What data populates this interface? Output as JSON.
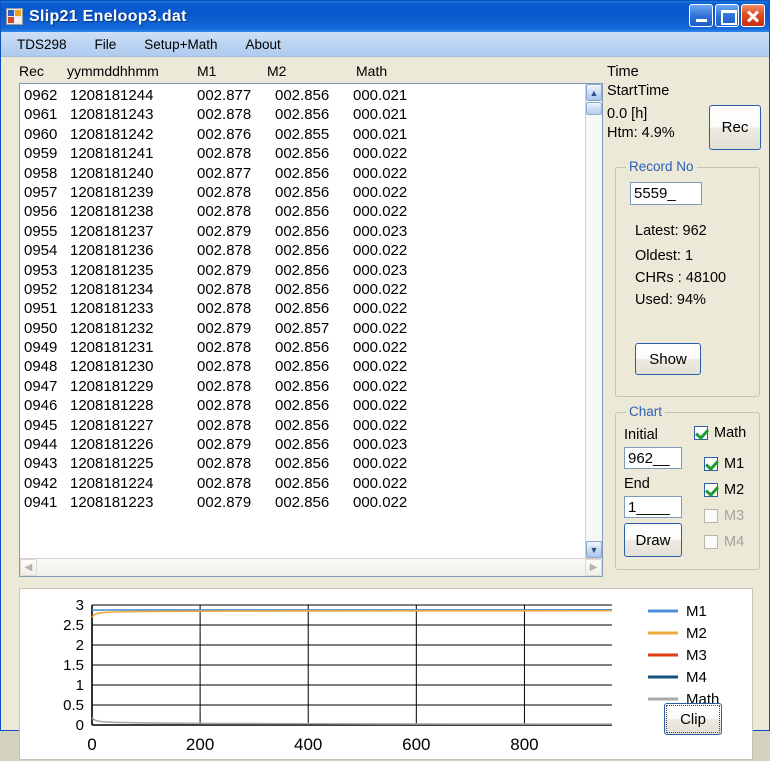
{
  "window": {
    "title": "Slip21 Eneloop3.dat",
    "icon": "app-icon",
    "buttons": {
      "minimize": "minimize-icon",
      "maximize": "maximize-icon",
      "close": "close-icon"
    }
  },
  "menubar": {
    "items": [
      {
        "label": "TDS298"
      },
      {
        "label": "File"
      },
      {
        "label": "Setup+Math"
      },
      {
        "label": "About"
      }
    ]
  },
  "list": {
    "headers": {
      "rec": "Rec",
      "date": "yymmddhhmm",
      "m1": "M1",
      "m2": "M2",
      "math": "Math"
    },
    "rows": [
      {
        "rec": "0962",
        "date": "1208181244",
        "m1": "002.877",
        "m2": "002.856",
        "math": "000.021"
      },
      {
        "rec": "0961",
        "date": "1208181243",
        "m1": "002.878",
        "m2": "002.856",
        "math": "000.021"
      },
      {
        "rec": "0960",
        "date": "1208181242",
        "m1": "002.876",
        "m2": "002.855",
        "math": "000.021"
      },
      {
        "rec": "0959",
        "date": "1208181241",
        "m1": "002.878",
        "m2": "002.856",
        "math": "000.022"
      },
      {
        "rec": "0958",
        "date": "1208181240",
        "m1": "002.877",
        "m2": "002.856",
        "math": "000.022"
      },
      {
        "rec": "0957",
        "date": "1208181239",
        "m1": "002.878",
        "m2": "002.856",
        "math": "000.022"
      },
      {
        "rec": "0956",
        "date": "1208181238",
        "m1": "002.878",
        "m2": "002.856",
        "math": "000.022"
      },
      {
        "rec": "0955",
        "date": "1208181237",
        "m1": "002.879",
        "m2": "002.856",
        "math": "000.023"
      },
      {
        "rec": "0954",
        "date": "1208181236",
        "m1": "002.878",
        "m2": "002.856",
        "math": "000.022"
      },
      {
        "rec": "0953",
        "date": "1208181235",
        "m1": "002.879",
        "m2": "002.856",
        "math": "000.023"
      },
      {
        "rec": "0952",
        "date": "1208181234",
        "m1": "002.878",
        "m2": "002.856",
        "math": "000.022"
      },
      {
        "rec": "0951",
        "date": "1208181233",
        "m1": "002.878",
        "m2": "002.856",
        "math": "000.022"
      },
      {
        "rec": "0950",
        "date": "1208181232",
        "m1": "002.879",
        "m2": "002.857",
        "math": "000.022"
      },
      {
        "rec": "0949",
        "date": "1208181231",
        "m1": "002.878",
        "m2": "002.856",
        "math": "000.022"
      },
      {
        "rec": "0948",
        "date": "1208181230",
        "m1": "002.878",
        "m2": "002.856",
        "math": "000.022"
      },
      {
        "rec": "0947",
        "date": "1208181229",
        "m1": "002.878",
        "m2": "002.856",
        "math": "000.022"
      },
      {
        "rec": "0946",
        "date": "1208181228",
        "m1": "002.878",
        "m2": "002.856",
        "math": "000.022"
      },
      {
        "rec": "0945",
        "date": "1208181227",
        "m1": "002.878",
        "m2": "002.856",
        "math": "000.022"
      },
      {
        "rec": "0944",
        "date": "1208181226",
        "m1": "002.879",
        "m2": "002.856",
        "math": "000.023"
      },
      {
        "rec": "0943",
        "date": "1208181225",
        "m1": "002.878",
        "m2": "002.856",
        "math": "000.022"
      },
      {
        "rec": "0942",
        "date": "1208181224",
        "m1": "002.878",
        "m2": "002.856",
        "math": "000.022"
      },
      {
        "rec": "0941",
        "date": "1208181223",
        "m1": "002.879",
        "m2": "002.856",
        "math": "000.022"
      }
    ]
  },
  "right_panel": {
    "time_label": "Time",
    "start_time_label": "StartTime",
    "elapsed": "0.0 [h]",
    "htm": "Htm: 4.9%",
    "rec_button": "Rec",
    "record_no": {
      "title": "Record No",
      "input_value": "5559_",
      "latest": "Latest: 962",
      "oldest": "Oldest: 1",
      "chrs": "CHRs : 48100",
      "used": "Used: 94%",
      "show_button": "Show"
    },
    "chart_group": {
      "title": "Chart",
      "initial_label": "Initial",
      "initial_value": "962__",
      "end_label": "End",
      "end_value": "1____",
      "draw_button": "Draw",
      "checkboxes": [
        {
          "label": "Math",
          "checked": true,
          "enabled": true
        },
        {
          "label": "M1",
          "checked": true,
          "enabled": true
        },
        {
          "label": "M2",
          "checked": true,
          "enabled": true
        },
        {
          "label": "M3",
          "checked": false,
          "enabled": false
        },
        {
          "label": "M4",
          "checked": false,
          "enabled": false
        }
      ]
    }
  },
  "chart_footer": {
    "clip_button": "Clip"
  },
  "colors": {
    "m1": "#4a90d9",
    "m2": "#f0a93b",
    "m3": "#e03c15",
    "m4": "#14527e",
    "math": "#a8a8a8",
    "axis": "#000000",
    "title_bar": "#0a56cc",
    "client": "#ece9d8"
  },
  "chart_data": {
    "type": "line",
    "title": "",
    "xlabel": "",
    "ylabel": "",
    "xlim": [
      0,
      962
    ],
    "ylim": [
      0,
      3
    ],
    "xticks": [
      0,
      200,
      400,
      600,
      800
    ],
    "yticks": [
      0,
      0.5,
      1,
      1.5,
      2,
      2.5,
      3
    ],
    "grid": true,
    "legend_position": "right",
    "legend": [
      "M1",
      "M2",
      "M3",
      "M4",
      "Math"
    ],
    "series": [
      {
        "name": "M1",
        "color": "#4a90d9",
        "visible": true,
        "x": [
          0,
          10,
          25,
          50,
          100,
          200,
          300,
          400,
          500,
          600,
          700,
          800,
          900,
          962
        ],
        "y": [
          2.872,
          2.874,
          2.875,
          2.876,
          2.876,
          2.877,
          2.877,
          2.877,
          2.877,
          2.878,
          2.878,
          2.878,
          2.879,
          2.879
        ]
      },
      {
        "name": "M2",
        "color": "#f0a93b",
        "visible": true,
        "x": [
          0,
          5,
          10,
          20,
          40,
          80,
          150,
          250,
          400,
          550,
          700,
          800,
          900,
          962
        ],
        "y": [
          2.7,
          2.76,
          2.79,
          2.81,
          2.825,
          2.835,
          2.843,
          2.848,
          2.851,
          2.853,
          2.855,
          2.855,
          2.856,
          2.856
        ]
      },
      {
        "name": "M3",
        "color": "#e03c15",
        "visible": false,
        "x": [],
        "y": []
      },
      {
        "name": "M4",
        "color": "#14527e",
        "visible": false,
        "x": [],
        "y": []
      },
      {
        "name": "Math",
        "color": "#a8a8a8",
        "visible": true,
        "x": [
          0,
          5,
          10,
          20,
          40,
          80,
          150,
          250,
          400,
          550,
          700,
          800,
          900,
          962
        ],
        "y": [
          0.18,
          0.125,
          0.1,
          0.082,
          0.068,
          0.055,
          0.045,
          0.037,
          0.031,
          0.027,
          0.024,
          0.023,
          0.022,
          0.022
        ]
      }
    ]
  }
}
